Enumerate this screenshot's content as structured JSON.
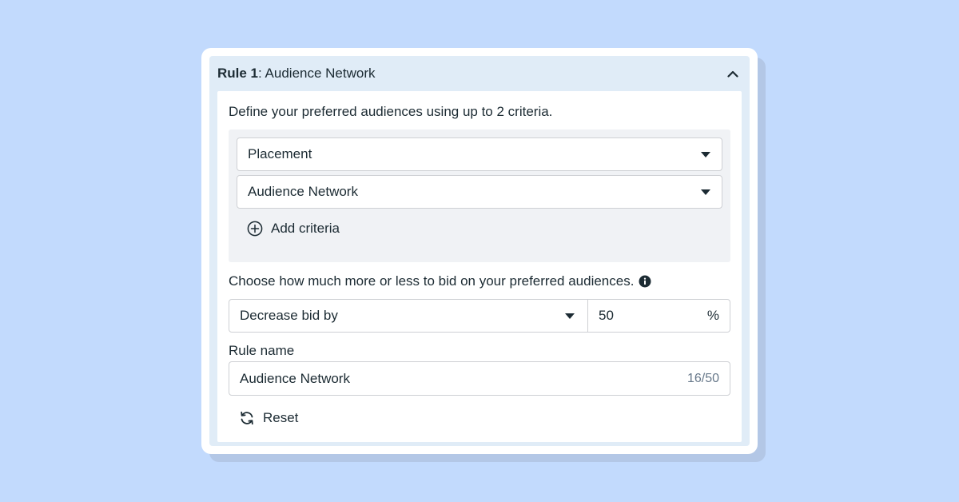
{
  "rule": {
    "number_label": "Rule 1",
    "name": "Audience Network",
    "description": "Define your preferred audiences using up to 2 criteria.",
    "criteria": [
      {
        "value": "Placement"
      },
      {
        "value": "Audience Network"
      }
    ],
    "add_criteria_label": "Add criteria",
    "bid": {
      "label": "Choose how much more or less to bid on your preferred audiences.",
      "action": "Decrease bid by",
      "value": "50",
      "unit": "%"
    },
    "rule_name": {
      "label": "Rule name",
      "value": "Audience Network",
      "counter": "16/50"
    },
    "reset_label": "Reset"
  },
  "colors": {
    "background": "#c2dafd",
    "panel": "#e0ecf7",
    "criteria_box": "#f0f2f5",
    "text": "#1c2b33"
  }
}
